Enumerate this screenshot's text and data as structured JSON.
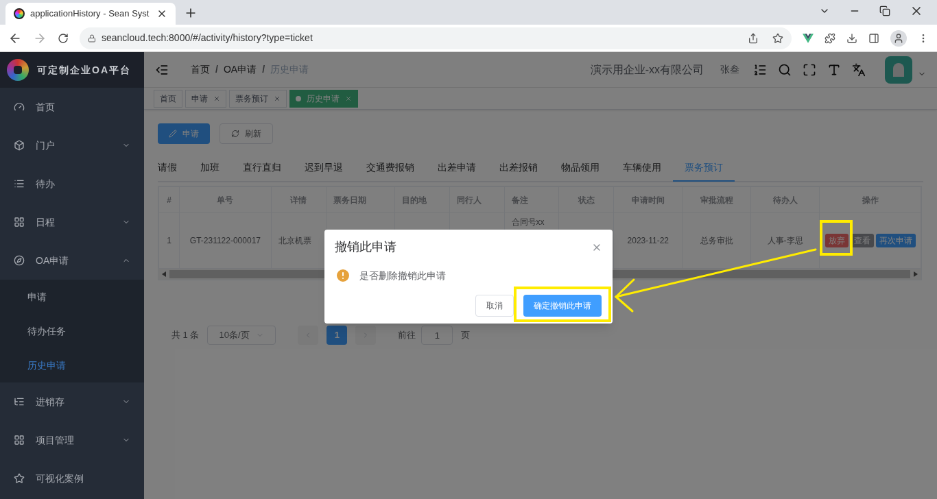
{
  "browser": {
    "tab_title": "applicationHistory - Sean Syst",
    "url": "seancloud.tech:8000/#/activity/history?type=ticket"
  },
  "sidebar": {
    "app_name": "可定制企业OA平台",
    "items": [
      {
        "label": "首页",
        "kind": "link",
        "selected": false
      },
      {
        "label": "门户",
        "kind": "menu",
        "expanded": false,
        "selected": false
      },
      {
        "label": "待办",
        "kind": "link",
        "selected": false
      },
      {
        "label": "日程",
        "kind": "menu",
        "expanded": false,
        "selected": false
      },
      {
        "label": "OA申请",
        "kind": "menu",
        "expanded": true,
        "selected": false,
        "children": [
          {
            "label": "申请",
            "selected": false
          },
          {
            "label": "待办任务",
            "selected": false
          },
          {
            "label": "历史申请",
            "selected": true
          }
        ]
      },
      {
        "label": "进销存",
        "kind": "menu",
        "expanded": false,
        "selected": false
      },
      {
        "label": "项目管理",
        "kind": "menu",
        "expanded": false,
        "selected": false
      },
      {
        "label": "可视化案例",
        "kind": "link",
        "selected": false
      }
    ]
  },
  "header": {
    "breadcrumb": [
      "首页",
      "OA申请",
      "历史申请"
    ],
    "separator": "/",
    "company": "演示用企业-xx有限公司",
    "user": "张叁"
  },
  "tags": [
    {
      "label": "首页",
      "closable": false,
      "selected": false
    },
    {
      "label": "申请",
      "closable": true,
      "selected": false
    },
    {
      "label": "票务预订",
      "closable": true,
      "selected": false
    },
    {
      "label": "历史申请",
      "closable": true,
      "selected": true
    }
  ],
  "toolbar": [
    {
      "label": "申请",
      "kind": "primary"
    },
    {
      "label": "刷新",
      "kind": "default"
    }
  ],
  "tabs": [
    {
      "label": "请假",
      "selected": false
    },
    {
      "label": "加班",
      "selected": false
    },
    {
      "label": "直行直归",
      "selected": false
    },
    {
      "label": "迟到早退",
      "selected": false
    },
    {
      "label": "交通费报销",
      "selected": false
    },
    {
      "label": "出差申请",
      "selected": false
    },
    {
      "label": "出差报销",
      "selected": false
    },
    {
      "label": "物品领用",
      "selected": false
    },
    {
      "label": "车辆使用",
      "selected": false
    },
    {
      "label": "票务预订",
      "selected": true
    }
  ],
  "table": {
    "columns": [
      "#",
      "单号",
      "详情",
      "票务日期",
      "目的地",
      "同行人",
      "备注",
      "状态",
      "申请时间",
      "审批流程",
      "待办人",
      "操作"
    ],
    "rows": [
      {
        "index": "1",
        "order_no": "GT-231122-000017",
        "detail": "北京机票",
        "remark": "合同号xx",
        "applied_at": "2023-11-22",
        "approval_flow": "总务审批",
        "assignee": "人事-李思",
        "actions": [
          {
            "label": "放弃",
            "kind": "danger"
          },
          {
            "label": "查看",
            "kind": "info"
          },
          {
            "label": "再次申请",
            "kind": "primary"
          }
        ]
      }
    ]
  },
  "pagination": {
    "total": "共 1 条",
    "page_size": "10条/页",
    "pages": [
      {
        "label": "1",
        "selected": true
      }
    ],
    "goto_label": "前往",
    "goto_value": "1",
    "page_suffix": "页"
  },
  "dialog": {
    "title": "撤销此申请",
    "message": "是否删除撤销此申请",
    "buttons": [
      {
        "label": "取消",
        "kind": "default"
      },
      {
        "label": "确定撤销此申请",
        "kind": "primary"
      }
    ]
  }
}
